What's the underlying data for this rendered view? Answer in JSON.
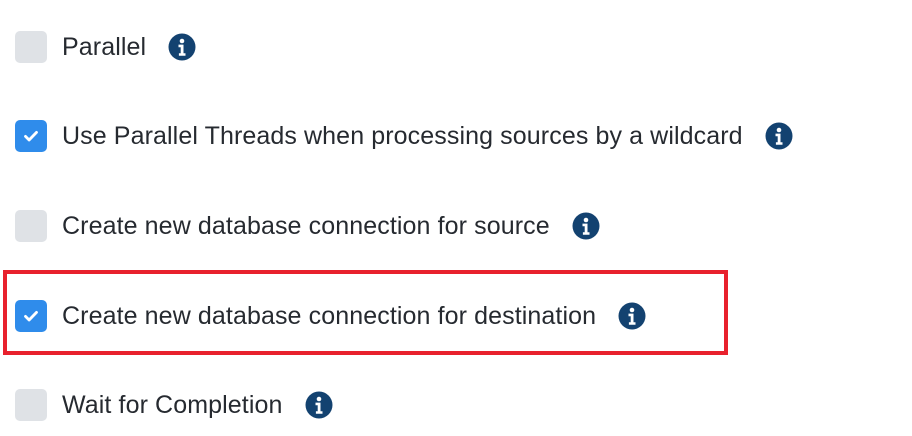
{
  "options": [
    {
      "label": "Parallel",
      "checked": false
    },
    {
      "label": "Use Parallel Threads when processing sources by a wildcard",
      "checked": true
    },
    {
      "label": "Create new database connection for source",
      "checked": false
    },
    {
      "label": "Create new database connection for destination",
      "checked": true,
      "highlighted": true
    },
    {
      "label": "Wait for Completion",
      "checked": false
    }
  ],
  "icons": {
    "info": "info-circle-icon",
    "check": "check-icon"
  },
  "colors": {
    "checkbox_checked": "#2f8ceb",
    "checkbox_unchecked": "#dfe2e6",
    "info_icon": "#134270",
    "highlight_border": "#e8212d",
    "label_text": "#262a30"
  }
}
